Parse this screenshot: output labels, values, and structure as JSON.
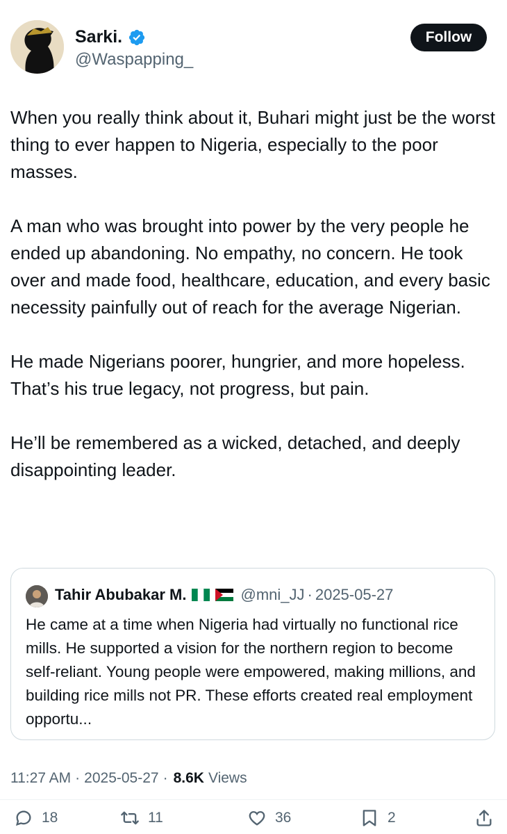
{
  "author": {
    "name": "Sarki.",
    "handle": "@Waspapping_",
    "follow_label": "Follow"
  },
  "tweet": {
    "paragraphs": [
      "When you really think about it, Buhari might just be the worst thing to ever happen to Nigeria, especially to the poor masses.",
      "A man who was brought into power by the very people he ended up abandoning. No empathy, no concern. He took over and made food, healthcare, education, and every basic necessity painfully out of reach for the average Nigerian.",
      "He made Nigerians poorer, hungrier, and more hopeless. That’s his true legacy, not progress, but pain.",
      "He’ll be remembered as a wicked, detached, and deeply disappointing leader."
    ]
  },
  "quote": {
    "name": "Tahir Abubakar M.",
    "handle": "@mni_JJ",
    "separator": "·",
    "date": "2025-05-27",
    "text": "He came at a time when Nigeria had virtually no functional rice mills. He supported a vision for the northern region to become self-reliant. Young people were empowered, making millions, and building rice mills not PR. These efforts created real employment opportu..."
  },
  "meta": {
    "time": "11:27 AM",
    "separator": "·",
    "date": "2025-05-27",
    "views_count": "8.6K",
    "views_label": "Views"
  },
  "actions": {
    "replies": "18",
    "reposts": "11",
    "likes": "36",
    "bookmarks": "2"
  },
  "icons": [
    "verified-badge-icon",
    "reply-icon",
    "repost-icon",
    "like-icon",
    "bookmark-icon",
    "share-icon",
    "nigeria-flag-icon",
    "palestine-flag-icon"
  ],
  "colors": {
    "accent": "#1d9bf0",
    "text": "#0f1419",
    "secondary": "#536471",
    "border": "#cfd9de"
  }
}
